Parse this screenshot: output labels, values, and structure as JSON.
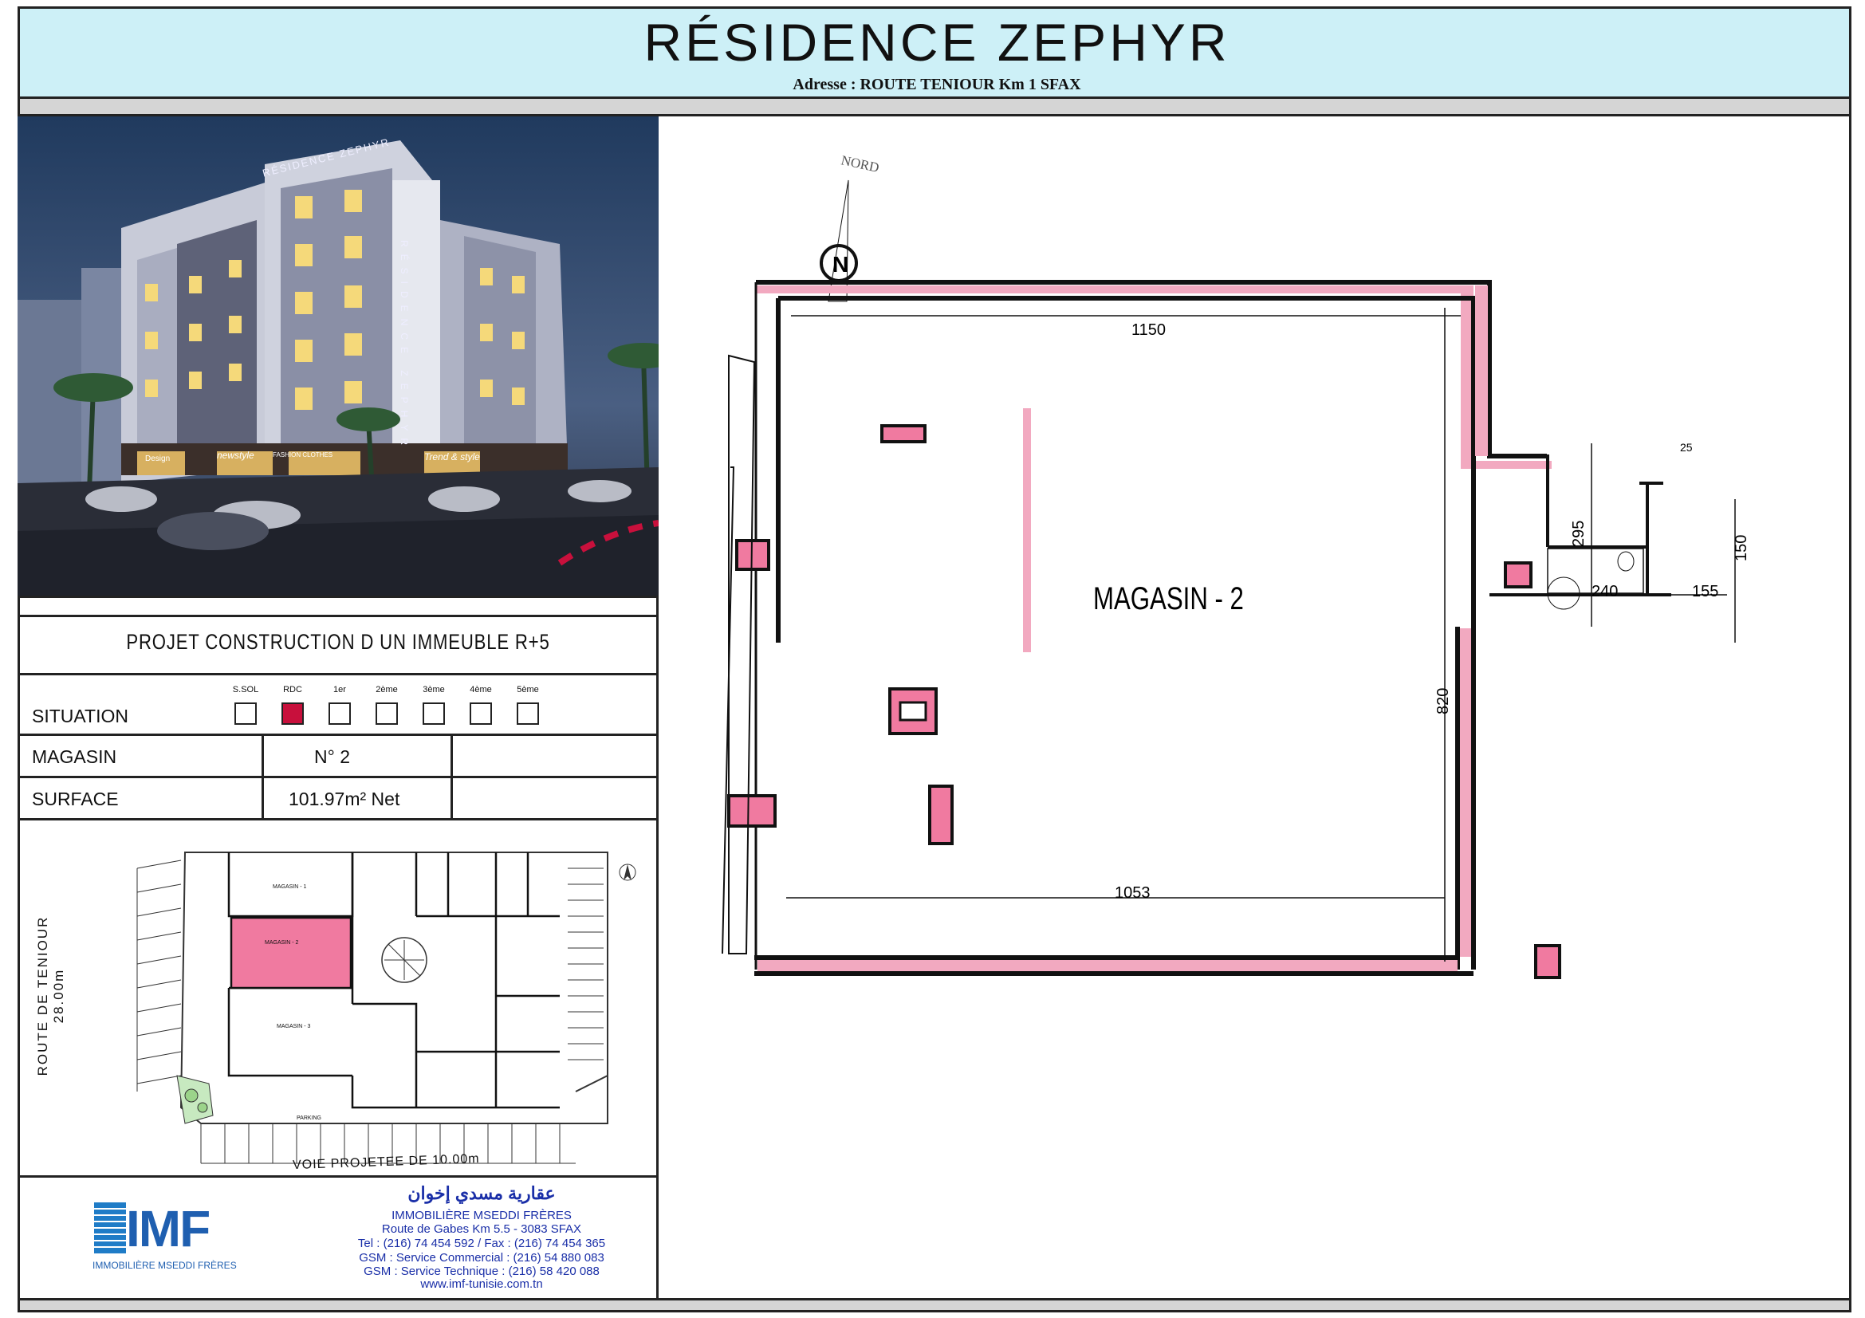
{
  "header": {
    "title": "RÉSIDENCE   ZEPHYR",
    "address": "Adresse : ROUTE TENIOUR  Km 1 SFAX"
  },
  "photo": {
    "building_sign": "RÉSIDENCE ZEPHYR",
    "vertical_sign": "RÉSIDENCE ZEPHYR",
    "shop_signs": [
      "newstyle",
      "FASHION CLOTHES",
      "Trend & style",
      "Design"
    ]
  },
  "project": {
    "label": "PROJET    CONSTRUCTION   D UN    IMMEUBLE    R+5"
  },
  "situation": {
    "label": "SITUATION",
    "levels": [
      {
        "name": "S.SOL",
        "active": false
      },
      {
        "name": "RDC",
        "active": true
      },
      {
        "name": "1er",
        "active": false
      },
      {
        "name": "2ème",
        "active": false
      },
      {
        "name": "3ème",
        "active": false
      },
      {
        "name": "4ème",
        "active": false
      },
      {
        "name": "5ème",
        "active": false
      }
    ]
  },
  "magasin": {
    "label": "MAGASIN",
    "value": "N°   2"
  },
  "surface": {
    "label": "SURFACE",
    "value": "101.97m² Net"
  },
  "site_plan": {
    "road_left": "ROUTE  DE  TENIOUR 28.00m",
    "road_bottom": "VOIE  PROJETEE  DE  10.00m",
    "shop1": "MAGASIN - 1",
    "shop2": "MAGASIN - 2",
    "shop3": "MAGASIN - 3",
    "parking": "PARKING"
  },
  "company": {
    "logo": "IMF",
    "logo_caption": "IMMOBILIÈRE  MSEDDI FRÈRES",
    "arabic_name": "عقارية مسدي إخوان",
    "name": "IMMOBILIÈRE  MSEDDI FRÈRES",
    "address": "Route de Gabes Km 5.5  -  3083 SFAX",
    "tel": "Tel : (216) 74 454 592 / Fax : (216) 74 454 365",
    "gsm_commercial": "GSM : Service Commercial    : (216) 54 880 083",
    "gsm_technique": "GSM : Service Technique      : (216) 58 420 088",
    "website": "www.imf-tunisie.com.tn"
  },
  "plan": {
    "north_label": "NORD",
    "north_letter": "N",
    "room_label": "MAGASIN - 2",
    "dims": {
      "top_width": "1150",
      "bottom_width": "1053",
      "height": "820",
      "notch_height": "295",
      "notch_width": "240",
      "wc_height": "150",
      "wc_width": "155",
      "wall_thickness": "25"
    }
  },
  "colors": {
    "title_band": "#cdf0f7",
    "active_level": "#c8103c",
    "wall_fill": "#f2a9c0",
    "shop_highlight": "#f07aa0",
    "company_blue": "#1a2fa8"
  }
}
